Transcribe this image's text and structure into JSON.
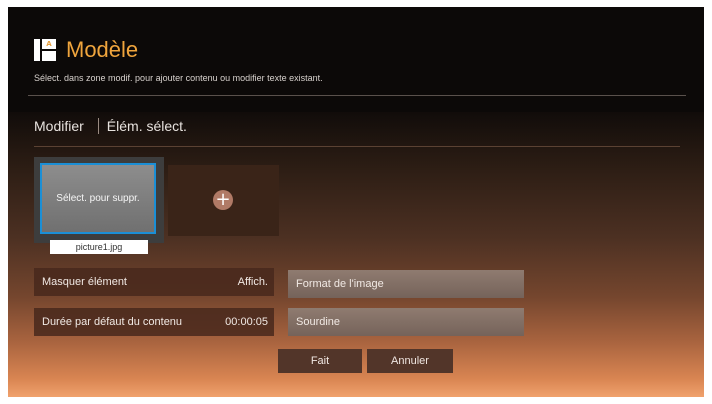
{
  "header": {
    "title": "Modèle",
    "subtitle": "Sélect. dans zone modif. pour ajouter contenu ou modifier texte existant.",
    "icon": "template-icon",
    "icon_letter": "A"
  },
  "breadcrumb": {
    "items": [
      "Modifier",
      "Élém. sélect."
    ]
  },
  "content": {
    "thumbnail_label": "Sélect. pour suppr.",
    "file_name": "picture1.jpg",
    "add_symbol": "+"
  },
  "settings": {
    "hide_element_label": "Masquer élément",
    "hide_element_value": "Affich.",
    "duration_label": "Durée par défaut du contenu",
    "duration_value": "00:00:05",
    "image_format_label": "Format de l'image",
    "mute_label": "Sourdine"
  },
  "footer": {
    "done_label": "Fait",
    "cancel_label": "Annuler"
  },
  "colors": {
    "accent": "#f0a53d",
    "selection": "#1b8fd6"
  }
}
